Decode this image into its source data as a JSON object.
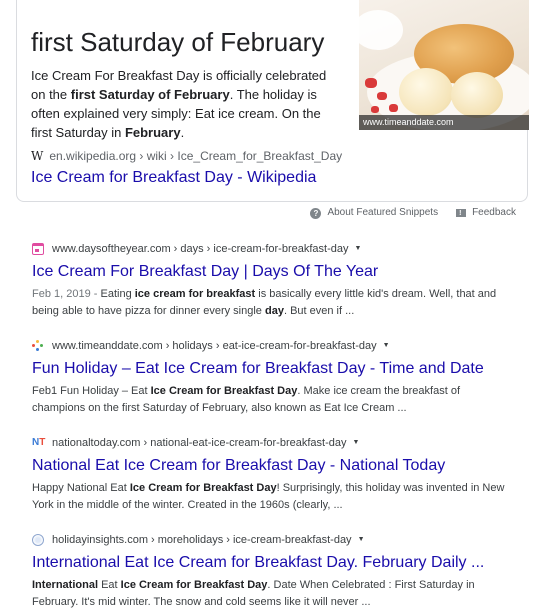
{
  "featured_snippet": {
    "answer": "first Saturday of February",
    "text_parts": [
      {
        "t": "Ice Cream For Breakfast Day is officially celebrated on the ",
        "b": false
      },
      {
        "t": "first Saturday of February",
        "b": true
      },
      {
        "t": ". The holiday is often explained very simply: Eat ice cream. On the first Saturday in ",
        "b": false
      },
      {
        "t": "February",
        "b": true
      },
      {
        "t": ".",
        "b": false
      }
    ],
    "image_credit": "www.timeanddate.com",
    "source_icon": "W",
    "source_breadcrumb": "en.wikipedia.org › wiki › Ice_Cream_for_Breakfast_Day",
    "title": "Ice Cream for Breakfast Day - Wikipedia"
  },
  "snippet_footer": {
    "about_label": "About Featured Snippets",
    "feedback_label": "Feedback"
  },
  "results": [
    {
      "favicon": "calendar-icon",
      "breadcrumb": "www.daysoftheyear.com › days › ice-cream-for-breakfast-day",
      "title": "Ice Cream For Breakfast Day | Days Of The Year",
      "snippet_parts": [
        {
          "t": "Feb 1, 2019 - ",
          "b": false,
          "date": true
        },
        {
          "t": "Eating ",
          "b": false
        },
        {
          "t": "ice cream for breakfast",
          "b": true
        },
        {
          "t": " is basically every little kid's dream. Well, that and being able to have pizza for dinner every single ",
          "b": false
        },
        {
          "t": "day",
          "b": true
        },
        {
          "t": ". But even if ...",
          "b": false
        }
      ]
    },
    {
      "favicon": "dots-icon",
      "breadcrumb": "www.timeanddate.com › holidays › eat-ice-cream-for-breakfast-day",
      "title": "Fun Holiday – Eat Ice Cream for Breakfast Day - Time and Date",
      "snippet_parts": [
        {
          "t": "Feb1 Fun Holiday – Eat ",
          "b": false
        },
        {
          "t": "Ice Cream for Breakfast Day",
          "b": true
        },
        {
          "t": ". Make ice cream the breakfast of champions on the first Saturday of February, also known as Eat Ice Cream ...",
          "b": false
        }
      ]
    },
    {
      "favicon": "nt-icon",
      "favicon_text": "NT",
      "breadcrumb": "nationaltoday.com › national-eat-ice-cream-for-breakfast-day",
      "title": "National Eat Ice Cream for Breakfast Day - National Today",
      "snippet_parts": [
        {
          "t": "Happy National Eat ",
          "b": false
        },
        {
          "t": "Ice Cream for Breakfast Day",
          "b": true
        },
        {
          "t": "! Surprisingly, this holiday was invented in New York in the middle of the winter. Created in the 1960s (clearly, ...",
          "b": false
        }
      ]
    },
    {
      "favicon": "globe-icon",
      "breadcrumb": "holidayinsights.com › moreholidays › ice-cream-breakfast-day",
      "title": "International Eat Ice Cream for Breakfast Day. February Daily ...",
      "snippet_parts": [
        {
          "t": "International",
          "b": true
        },
        {
          "t": " Eat ",
          "b": false
        },
        {
          "t": "Ice Cream for Breakfast Day",
          "b": true
        },
        {
          "t": ". Date When Celebrated : First Saturday in February. It's mid winter. The snow and cold seems like it will never ...",
          "b": false
        }
      ]
    }
  ],
  "colors": {
    "link": "#1a0dab",
    "text": "#202124",
    "muted": "#5f6368",
    "border": "#dadce0"
  }
}
